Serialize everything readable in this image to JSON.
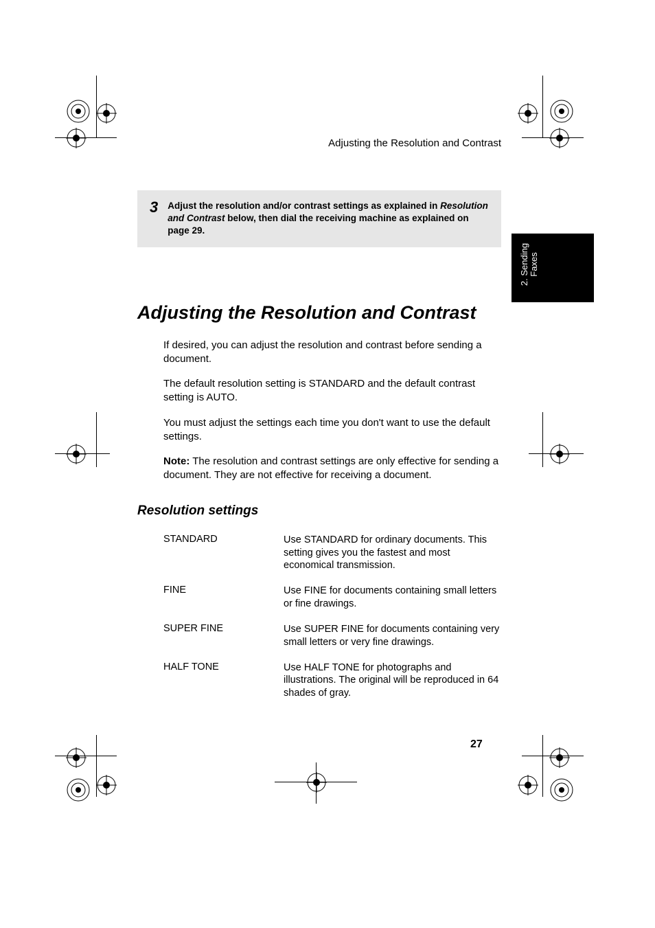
{
  "running_head": "Adjusting the Resolution and Contrast",
  "step": {
    "number": "3",
    "text_before": "Adjust the resolution and/or contrast settings as explained in ",
    "emphasis": "Resolution and Contrast",
    "text_after": " below, then dial the receiving machine as explained on page 29."
  },
  "side_tab": {
    "line1": "2. Sending",
    "line2": "Faxes"
  },
  "section_title": "Adjusting the Resolution and Contrast",
  "intro": {
    "p1": "If desired, you can adjust the resolution and contrast before sending a document.",
    "p2": "The default resolution setting is STANDARD and the default contrast setting is AUTO.",
    "p3": "You must adjust the settings each time you don't want to use the default settings.",
    "note_label": "Note:",
    "note_text": " The resolution and contrast settings are only effective for sending a document. They are not effective for receiving a document."
  },
  "sub_title": "Resolution settings",
  "settings": [
    {
      "name": "STANDARD",
      "desc": "Use STANDARD for ordinary documents. This setting gives you the fastest and most economical transmission."
    },
    {
      "name": "FINE",
      "desc": "Use FINE for documents containing small letters or fine drawings."
    },
    {
      "name": "SUPER FINE",
      "desc": "Use SUPER FINE for documents containing very small letters or very fine drawings."
    },
    {
      "name": "HALF TONE",
      "desc": "Use HALF TONE for photographs and illustrations. The original will be reproduced in 64 shades of gray."
    }
  ],
  "page_number": "27"
}
